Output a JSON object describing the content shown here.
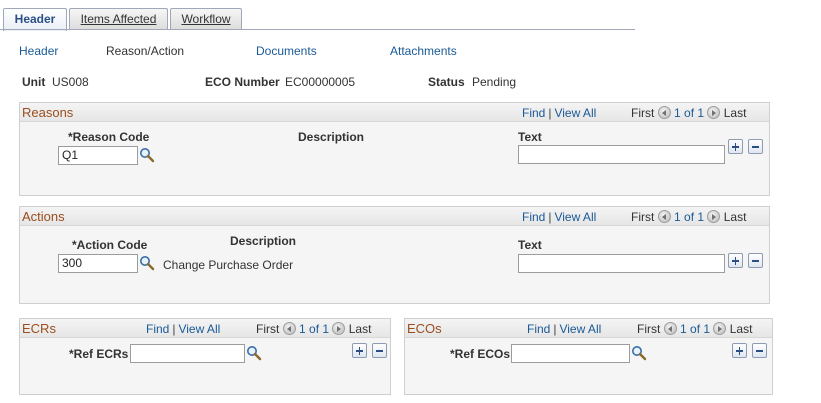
{
  "tabs": [
    {
      "label": "Header",
      "active": true
    },
    {
      "label": "Items Affected",
      "active": false
    },
    {
      "label": "Workflow",
      "active": false
    }
  ],
  "subnav": {
    "header": "Header",
    "reason_action": "Reason/Action",
    "documents": "Documents",
    "attachments": "Attachments"
  },
  "info": {
    "unit_label": "Unit",
    "unit_value": "US008",
    "eco_label": "ECO Number",
    "eco_value": "EC00000005",
    "status_label": "Status",
    "status_value": "Pending"
  },
  "reasons": {
    "title": "Reasons",
    "find": "Find",
    "view_all": "View All",
    "first": "First",
    "count": "1 of 1",
    "last": "Last",
    "code_label": "*Reason Code",
    "code_value": "Q1",
    "description_label": "Description",
    "description_value": "",
    "text_label": "Text",
    "text_value": ""
  },
  "actions": {
    "title": "Actions",
    "find": "Find",
    "view_all": "View All",
    "first": "First",
    "count": "1 of 1",
    "last": "Last",
    "code_label": "*Action Code",
    "code_value": "300",
    "description_label": "Description",
    "description_value": "Change Purchase Order",
    "text_label": "Text",
    "text_value": ""
  },
  "ecrs": {
    "title": "ECRs",
    "find": "Find",
    "view_all": "View All",
    "first": "First",
    "count": "1 of 1",
    "last": "Last",
    "field_label": "*Ref ECRs",
    "field_value": ""
  },
  "ecos": {
    "title": "ECOs",
    "find": "Find",
    "view_all": "View All",
    "first": "First",
    "count": "1 of 1",
    "last": "Last",
    "field_label": "*Ref ECOs",
    "field_value": ""
  },
  "colors": {
    "link": "#1a5a96",
    "group_title": "#9a4d1e",
    "tab_active": "#2a4f86"
  }
}
